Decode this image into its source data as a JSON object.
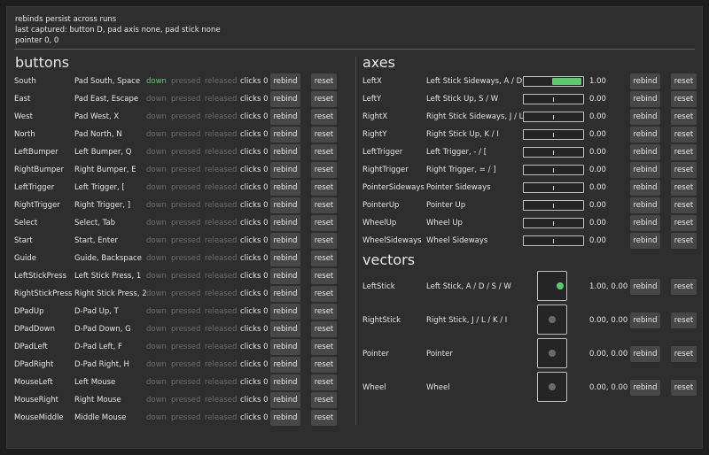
{
  "info": {
    "line1": "rebinds persist across runs",
    "line2": "last captured: button D, pad axis none, pad stick none",
    "line3": "pointer 0, 0"
  },
  "buttons": {
    "title": "buttons",
    "rebind_label": "rebind",
    "reset_label": "reset",
    "state_labels": [
      "down",
      "pressed",
      "released"
    ],
    "items": [
      {
        "name": "South",
        "binding": "Pad South, Space",
        "down": true,
        "clicks": "clicks 0"
      },
      {
        "name": "East",
        "binding": "Pad East, Escape",
        "down": false,
        "clicks": "clicks 0"
      },
      {
        "name": "West",
        "binding": "Pad West, X",
        "down": false,
        "clicks": "clicks 0"
      },
      {
        "name": "North",
        "binding": "Pad North, N",
        "down": false,
        "clicks": "clicks 0"
      },
      {
        "name": "LeftBumper",
        "binding": "Left Bumper, Q",
        "down": false,
        "clicks": "clicks 0"
      },
      {
        "name": "RightBumper",
        "binding": "Right Bumper, E",
        "down": false,
        "clicks": "clicks 0"
      },
      {
        "name": "LeftTrigger",
        "binding": "Left Trigger, [",
        "down": false,
        "clicks": "clicks 0"
      },
      {
        "name": "RightTrigger",
        "binding": "Right Trigger, ]",
        "down": false,
        "clicks": "clicks 0"
      },
      {
        "name": "Select",
        "binding": "Select, Tab",
        "down": false,
        "clicks": "clicks 0"
      },
      {
        "name": "Start",
        "binding": "Start, Enter",
        "down": false,
        "clicks": "clicks 0"
      },
      {
        "name": "Guide",
        "binding": "Guide, Backspace",
        "down": false,
        "clicks": "clicks 0"
      },
      {
        "name": "LeftStickPress",
        "binding": "Left Stick Press, 1",
        "down": false,
        "clicks": "clicks 0"
      },
      {
        "name": "RightStickPress",
        "binding": "Right Stick Press, 2",
        "down": false,
        "clicks": "clicks 0"
      },
      {
        "name": "DPadUp",
        "binding": "D-Pad Up, T",
        "down": false,
        "clicks": "clicks 0"
      },
      {
        "name": "DPadDown",
        "binding": "D-Pad Down, G",
        "down": false,
        "clicks": "clicks 0"
      },
      {
        "name": "DPadLeft",
        "binding": "D-Pad Left, F",
        "down": false,
        "clicks": "clicks 0"
      },
      {
        "name": "DPadRight",
        "binding": "D-Pad Right, H",
        "down": false,
        "clicks": "clicks 0"
      },
      {
        "name": "MouseLeft",
        "binding": "Left Mouse",
        "down": false,
        "clicks": "clicks 0"
      },
      {
        "name": "MouseRight",
        "binding": "Right Mouse",
        "down": false,
        "clicks": "clicks 0"
      },
      {
        "name": "MouseMiddle",
        "binding": "Middle Mouse",
        "down": false,
        "clicks": "clicks 0"
      }
    ]
  },
  "axes": {
    "title": "axes",
    "rebind_label": "rebind",
    "reset_label": "reset",
    "items": [
      {
        "name": "LeftX",
        "binding": "Left Stick Sideways, A / D",
        "value": "1.00",
        "level": 1.0
      },
      {
        "name": "LeftY",
        "binding": "Left Stick Up, S / W",
        "value": "0.00",
        "level": 0
      },
      {
        "name": "RightX",
        "binding": "Right Stick Sideways, J / L",
        "value": "0.00",
        "level": 0
      },
      {
        "name": "RightY",
        "binding": "Right Stick Up, K / I",
        "value": "0.00",
        "level": 0
      },
      {
        "name": "LeftTrigger",
        "binding": "Left Trigger, - / [",
        "value": "0.00",
        "level": 0
      },
      {
        "name": "RightTrigger",
        "binding": "Right Trigger, = / ]",
        "value": "0.00",
        "level": 0
      },
      {
        "name": "PointerSideways",
        "binding": "Pointer Sideways",
        "value": "0.00",
        "level": 0
      },
      {
        "name": "PointerUp",
        "binding": "Pointer Up",
        "value": "0.00",
        "level": 0
      },
      {
        "name": "WheelUp",
        "binding": "Wheel Up",
        "value": "0.00",
        "level": 0
      },
      {
        "name": "WheelSideways",
        "binding": "Wheel Sideways",
        "value": "0.00",
        "level": 0
      }
    ]
  },
  "vectors": {
    "title": "vectors",
    "rebind_label": "rebind",
    "reset_label": "reset",
    "items": [
      {
        "name": "LeftStick",
        "binding": "Left Stick, A / D / S / W",
        "value": "1.00, 0.00",
        "vx": 1.0,
        "vy": 0.0,
        "active": true
      },
      {
        "name": "RightStick",
        "binding": "Right Stick, J / L / K / I",
        "value": "0.00, 0.00",
        "vx": 0,
        "vy": 0,
        "active": false
      },
      {
        "name": "Pointer",
        "binding": "Pointer",
        "value": "0.00, 0.00",
        "vx": 0,
        "vy": 0,
        "active": false
      },
      {
        "name": "Wheel",
        "binding": "Wheel",
        "value": "0.00, 0.00",
        "vx": 0,
        "vy": 0,
        "active": false
      }
    ]
  },
  "colors": {
    "accent": "#5fc86e",
    "background": "#2e2e2e",
    "button": "#474747"
  }
}
